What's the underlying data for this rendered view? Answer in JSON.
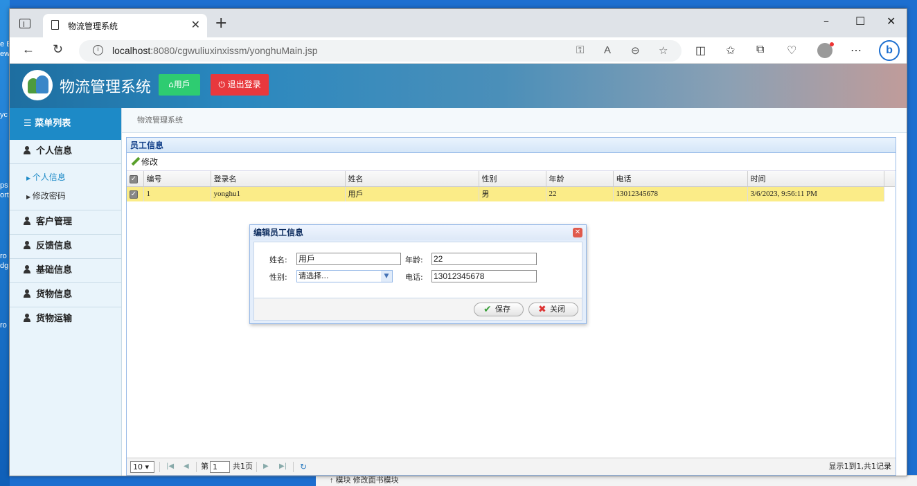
{
  "desktop": {
    "fragments": [
      "e E",
      "ew",
      "yc",
      "ps",
      "ort",
      "ro",
      "dg",
      "ro"
    ],
    "behind_text": "↑ 模块 修改面书模块"
  },
  "browser": {
    "tab_title": "物流管理系统",
    "url_host": "localhost",
    "url_rest": ":8080/cgwuliuxinxissm/yonghuMain.jsp"
  },
  "header": {
    "site_title": "物流管理系统",
    "user_btn": "用戶",
    "logout_btn": "退出登录",
    "user_icon": "home-icon",
    "logout_icon": "power-icon"
  },
  "sidebar": {
    "menu_title": "菜单列表",
    "categories": [
      {
        "label": "个人信息",
        "items": [
          {
            "label": "个人信息"
          },
          {
            "label": "修改密码"
          }
        ]
      },
      {
        "label": "客户管理"
      },
      {
        "label": "反馈信息"
      },
      {
        "label": "基础信息"
      },
      {
        "label": "货物信息"
      },
      {
        "label": "货物运输"
      }
    ]
  },
  "breadcrumb": "物流管理系统",
  "panel": {
    "title": "员工信息",
    "edit_btn": "修改",
    "columns": [
      "编号",
      "登录名",
      "姓名",
      "性别",
      "年龄",
      "电话",
      "时间"
    ],
    "rows": [
      [
        "1",
        "yonghu1",
        "用戶",
        "男",
        "22",
        "13012345678",
        "3/6/2023, 9:56:11 PM"
      ]
    ]
  },
  "pager": {
    "page_size": "10",
    "page_prefix": "第",
    "page_num": "1",
    "page_total": "共1页",
    "info": "显示1到1,共1记录"
  },
  "dialog": {
    "title": "编辑员工信息",
    "name_label": "姓名:",
    "name_value": "用戶",
    "age_label": "年龄:",
    "age_value": "22",
    "gender_label": "性别:",
    "gender_value": "请选择...",
    "phone_label": "电话:",
    "phone_value": "13012345678",
    "save_btn": "保存",
    "close_btn": "关闭"
  },
  "colors": {
    "sidebar_head": "#1d8ac7",
    "user_btn": "#2ecc71",
    "logout_btn": "#e8383d",
    "row_highlight": "#fbec88"
  }
}
